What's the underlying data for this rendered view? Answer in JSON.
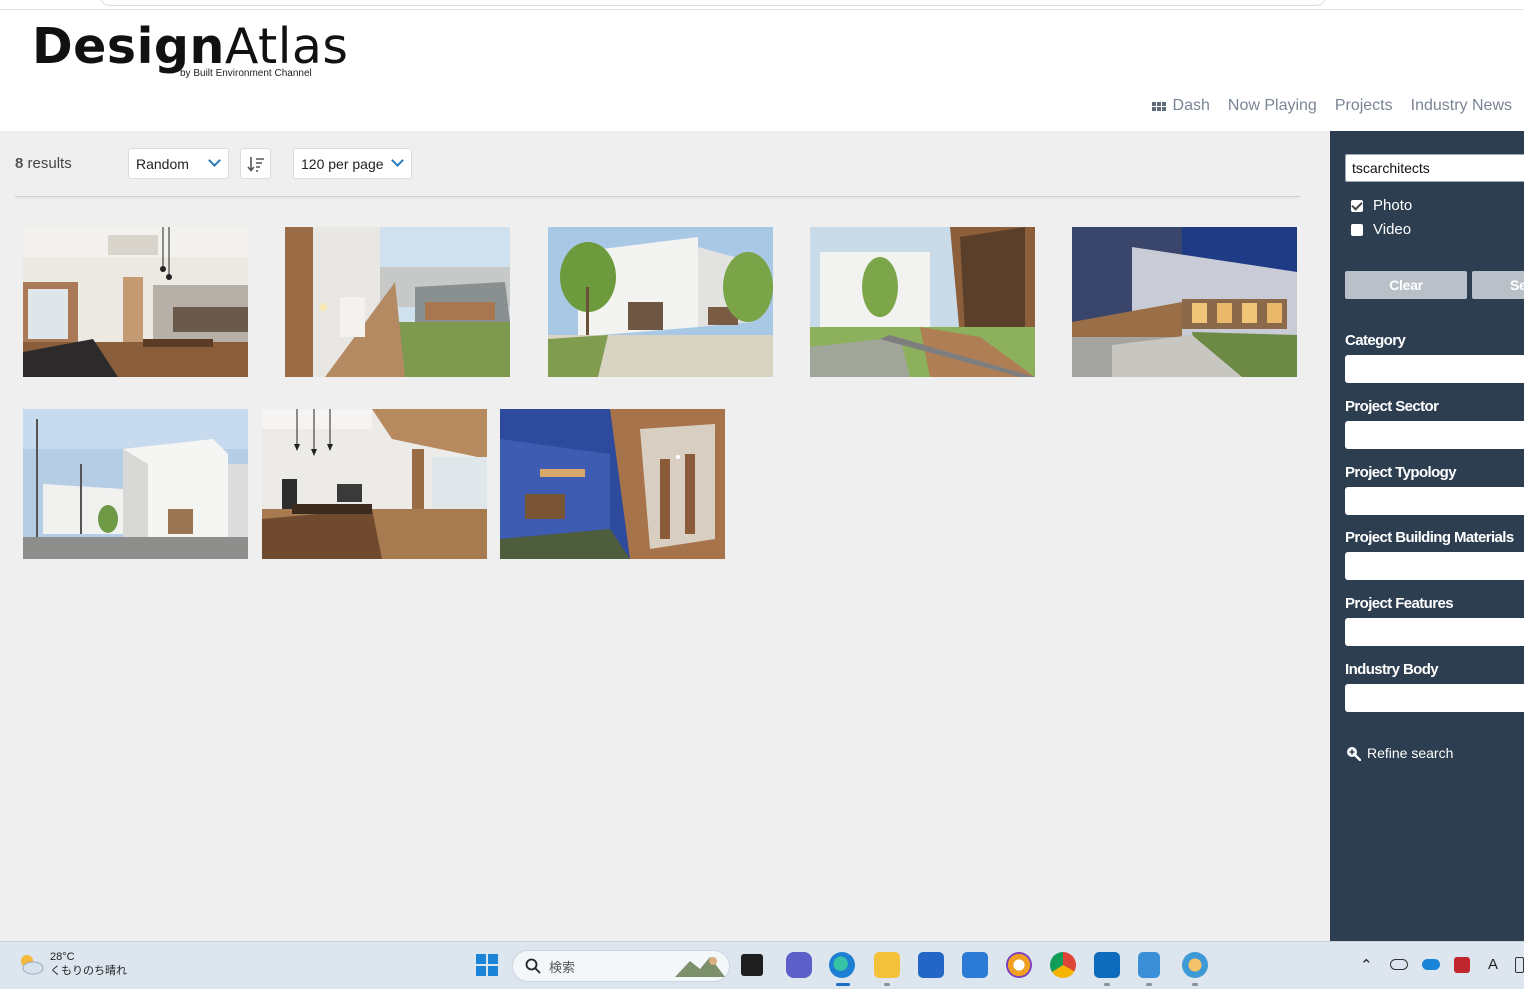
{
  "logo": {
    "brand_bold": "Design",
    "brand_light": "Atlas",
    "tagline": "by Built Environment Channel"
  },
  "nav": [
    {
      "label": "Dash",
      "icon": "grid-icon"
    },
    {
      "label": "Now Playing"
    },
    {
      "label": "Projects"
    },
    {
      "label": "Industry News"
    }
  ],
  "toolbar": {
    "results_count": "8",
    "results_label": "results",
    "sort_value": "Random",
    "per_page_value": "120 per page"
  },
  "sidebar": {
    "search_value": "tscarchitects",
    "checkboxes": [
      {
        "label": "Photo",
        "checked": true
      },
      {
        "label": "Video",
        "checked": false
      }
    ],
    "clear_label": "Clear",
    "search_button_label": "Se",
    "filters": [
      "Category",
      "Project Sector",
      "Project Typology",
      "Project Building Materials",
      "Project Features",
      "Industry Body"
    ],
    "refine_label": "Refine search"
  },
  "taskbar": {
    "temperature": "28°C",
    "weather_desc": "くもりのち晴れ",
    "search_placeholder": "検索"
  },
  "colors": {
    "sidebar_bg": "#2c3e50",
    "main_bg": "#efefef",
    "button_grey": "#b9c0c7",
    "accent_blue": "#2a7ab8"
  }
}
